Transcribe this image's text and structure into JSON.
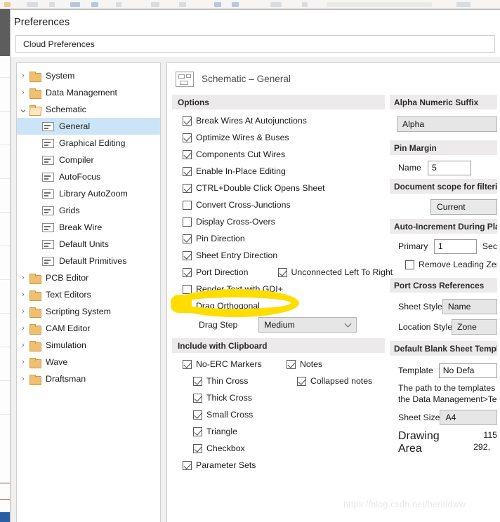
{
  "window": {
    "title": "Preferences",
    "cloud_preferences_label": "Cloud Preferences"
  },
  "tree": {
    "items": [
      {
        "label": "System",
        "type": "folder",
        "indent": 0,
        "expander": "collapsed",
        "selected": false
      },
      {
        "label": "Data Management",
        "type": "folder",
        "indent": 0,
        "expander": "collapsed",
        "selected": false
      },
      {
        "label": "Schematic",
        "type": "folder-open",
        "indent": 0,
        "expander": "expanded",
        "selected": false
      },
      {
        "label": "General",
        "type": "page",
        "indent": 1,
        "expander": "none",
        "selected": true
      },
      {
        "label": "Graphical Editing",
        "type": "page",
        "indent": 1,
        "expander": "none",
        "selected": false
      },
      {
        "label": "Compiler",
        "type": "page",
        "indent": 1,
        "expander": "none",
        "selected": false
      },
      {
        "label": "AutoFocus",
        "type": "page",
        "indent": 1,
        "expander": "none",
        "selected": false
      },
      {
        "label": "Library AutoZoom",
        "type": "page",
        "indent": 1,
        "expander": "none",
        "selected": false
      },
      {
        "label": "Grids",
        "type": "page",
        "indent": 1,
        "expander": "none",
        "selected": false
      },
      {
        "label": "Break Wire",
        "type": "page",
        "indent": 1,
        "expander": "none",
        "selected": false
      },
      {
        "label": "Default Units",
        "type": "page",
        "indent": 1,
        "expander": "none",
        "selected": false
      },
      {
        "label": "Default Primitives",
        "type": "page",
        "indent": 1,
        "expander": "none",
        "selected": false
      },
      {
        "label": "PCB Editor",
        "type": "folder",
        "indent": 0,
        "expander": "collapsed",
        "selected": false
      },
      {
        "label": "Text Editors",
        "type": "folder",
        "indent": 0,
        "expander": "collapsed",
        "selected": false
      },
      {
        "label": "Scripting System",
        "type": "folder",
        "indent": 0,
        "expander": "collapsed",
        "selected": false
      },
      {
        "label": "CAM Editor",
        "type": "folder",
        "indent": 0,
        "expander": "collapsed",
        "selected": false
      },
      {
        "label": "Simulation",
        "type": "folder",
        "indent": 0,
        "expander": "collapsed",
        "selected": false
      },
      {
        "label": "Wave",
        "type": "folder",
        "indent": 0,
        "expander": "collapsed",
        "selected": false
      },
      {
        "label": "Draftsman",
        "type": "folder",
        "indent": 0,
        "expander": "collapsed",
        "selected": false
      }
    ]
  },
  "page": {
    "title": "Schematic – General",
    "icon": "schematic-icon"
  },
  "options": {
    "heading": "Options",
    "checkboxes": [
      {
        "label": "Break Wires At Autojunctions",
        "checked": true
      },
      {
        "label": "Optimize Wires & Buses",
        "checked": true
      },
      {
        "label": "Components Cut Wires",
        "checked": true
      },
      {
        "label": "Enable In-Place Editing",
        "checked": true
      },
      {
        "label": "CTRL+Double Click Opens Sheet",
        "checked": true
      },
      {
        "label": "Convert Cross-Junctions",
        "checked": false
      },
      {
        "label": "Display Cross-Overs",
        "checked": false
      },
      {
        "label": "Pin Direction",
        "checked": true
      },
      {
        "label": "Sheet Entry Direction",
        "checked": true
      },
      {
        "label": "Port Direction",
        "checked": true
      },
      {
        "label": "Render Text with GDI+",
        "checked": false
      },
      {
        "label": "Drag Orthogonal",
        "checked": true
      }
    ],
    "unconnected_left_to_right": {
      "label": "Unconnected Left To Right",
      "checked": true
    },
    "drag_step": {
      "label": "Drag Step",
      "value": "Medium"
    }
  },
  "clipboard": {
    "heading": "Include with Clipboard",
    "left_items": [
      {
        "label": "No-ERC Markers",
        "checked": true,
        "indent": 0
      },
      {
        "label": "Thin Cross",
        "checked": true,
        "indent": 1
      },
      {
        "label": "Thick Cross",
        "checked": true,
        "indent": 1
      },
      {
        "label": "Small Cross",
        "checked": true,
        "indent": 1
      },
      {
        "label": "Triangle",
        "checked": true,
        "indent": 1
      },
      {
        "label": "Checkbox",
        "checked": true,
        "indent": 1
      },
      {
        "label": "Parameter Sets",
        "checked": true,
        "indent": 0
      }
    ],
    "right_items": [
      {
        "label": "Notes",
        "checked": true,
        "indent": 0
      },
      {
        "label": "Collapsed notes",
        "checked": true,
        "indent": 1
      }
    ]
  },
  "alpha_numeric_suffix": {
    "heading": "Alpha Numeric Suffix",
    "value": "Alpha"
  },
  "pin_margin": {
    "heading": "Pin Margin",
    "name_label": "Name",
    "name_value": "5"
  },
  "document_scope": {
    "heading": "Document scope for filtering",
    "value": "Current"
  },
  "auto_increment": {
    "heading": "Auto-Increment During Place",
    "primary_label": "Primary",
    "primary_value": "1",
    "secondary_label": "Sec",
    "remove_leading_zeroes": {
      "label": "Remove Leading Zeroes",
      "checked": false
    }
  },
  "port_cross_references": {
    "heading": "Port Cross References",
    "sheet_style_label": "Sheet Style",
    "sheet_style_value": "Name",
    "location_style_label": "Location Style",
    "location_style_value": "Zone"
  },
  "default_blank_sheet": {
    "heading": "Default Blank Sheet Template",
    "template_label": "Template",
    "template_value": "No Defa",
    "path_note_line1": "The path to the templates",
    "path_note_line2": "the Data Management>Te",
    "sheet_size_label": "Sheet Size",
    "sheet_size_value": "A4",
    "drawing_area_label": "Drawing Area",
    "drawing_area_value_line1": "115",
    "drawing_area_value_line2": "292,"
  },
  "annotation": {
    "type": "highlight-ellipse",
    "color": "#ffdd00",
    "target": "Render Text with GDI+"
  },
  "watermark": {
    "text": "https://blog.csdn.net/heraldww"
  }
}
